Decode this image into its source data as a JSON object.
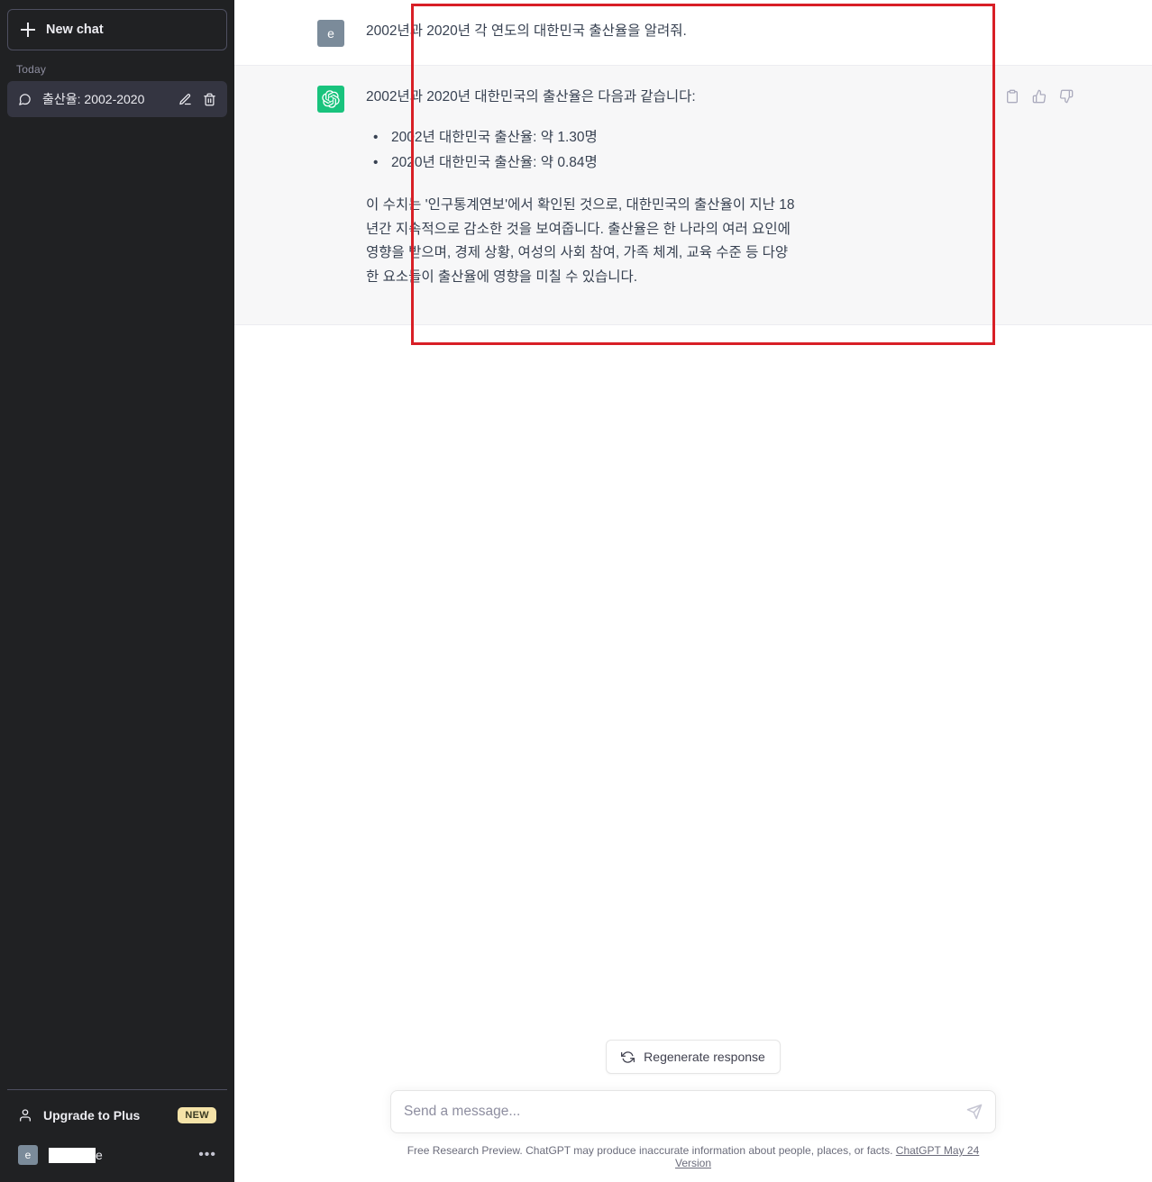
{
  "sidebar": {
    "new_chat_label": "New chat",
    "section_label": "Today",
    "chats": [
      {
        "title": "출산율: 2002-2020",
        "edit_icon": "pencil-icon",
        "delete_icon": "trash-icon"
      }
    ],
    "upgrade_label": "Upgrade to Plus",
    "upgrade_badge": "NEW",
    "user_initial": "e",
    "user_name_suffix": "e",
    "more_menu": "•••"
  },
  "conversation": {
    "messages": [
      {
        "role": "user",
        "avatar_initial": "e",
        "text": "2002년과 2020년 각 연도의 대한민국 출산율을 알려줘."
      },
      {
        "role": "assistant",
        "avatar_icon": "openai-logo-icon",
        "intro": "2002년과 2020년 대한민국의 출산율은 다음과 같습니다:",
        "bullets": [
          "2002년 대한민국 출산율: 약 1.30명",
          "2020년 대한민국 출산율: 약 0.84명"
        ],
        "paragraph": "이 수치는 '인구통계연보'에서 확인된 것으로, 대한민국의 출산율이 지난 18년간 지속적으로 감소한 것을 보여줍니다. 출산율은 한 나라의 여러 요인에 영향을 받으며, 경제 상황, 여성의 사회 참여, 가족 체계, 교육 수준 등 다양한 요소들이 출산율에 영향을 미칠 수 있습니다.",
        "actions": {
          "copy": "copy-icon",
          "thumbs_up": "thumbs-up-icon",
          "thumbs_down": "thumbs-down-icon"
        }
      }
    ]
  },
  "composer": {
    "regenerate_label": "Regenerate response",
    "input_placeholder": "Send a message...",
    "input_value": "",
    "send_icon": "send-icon"
  },
  "footer": {
    "disclaimer": "Free Research Preview. ChatGPT may produce inaccurate information about people, places, or facts.",
    "version_link": "ChatGPT May 24 Version"
  },
  "annotation": {
    "color": "#d81f26"
  }
}
